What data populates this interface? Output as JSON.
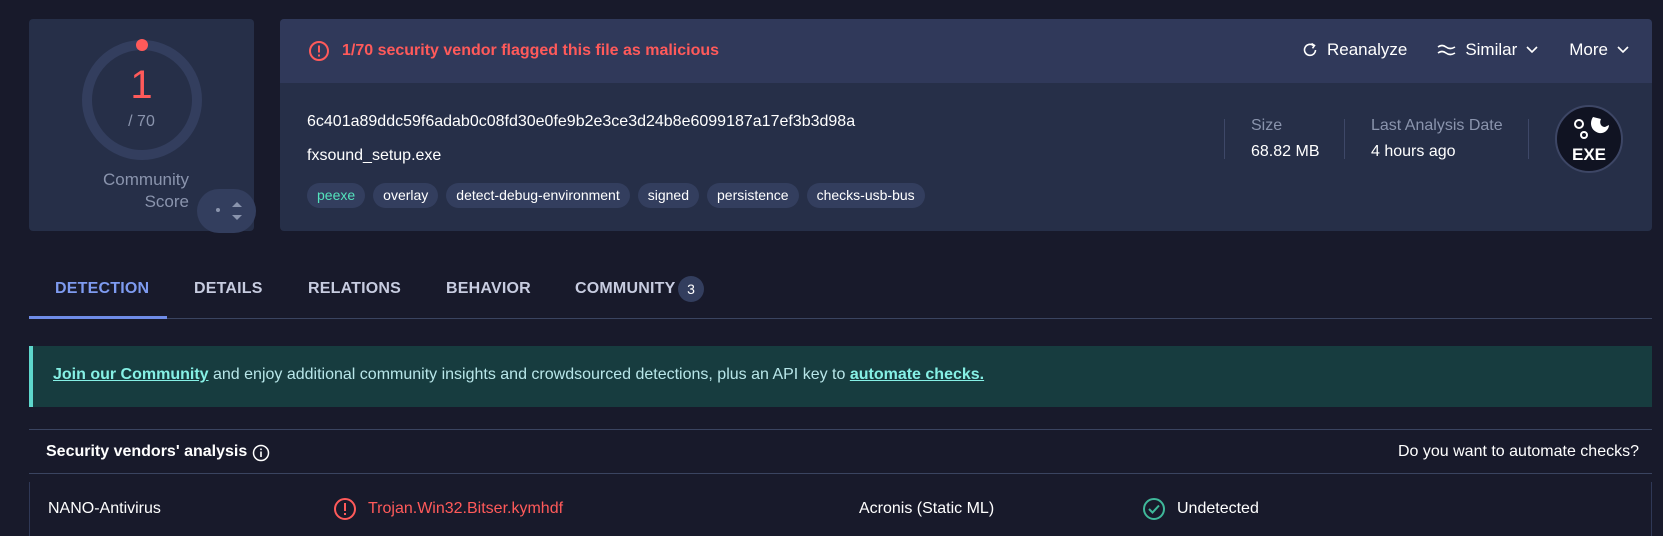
{
  "score": {
    "detections": "1",
    "total": "/ 70",
    "community_label_1": "Community",
    "community_label_2": "Score",
    "detection_ratio": 0.0143
  },
  "alert": {
    "text": "1/70 security vendor flagged this file as malicious"
  },
  "actions": {
    "reanalyze": "Reanalyze",
    "similar": "Similar",
    "more": "More"
  },
  "file": {
    "hash": "6c401a89ddc59f6adab0c08fd30e0fe9b2e3ce3d24b8e6099187a17ef3b3d98a",
    "name": "fxsound_setup.exe",
    "tags": [
      "peexe",
      "overlay",
      "detect-debug-environment",
      "signed",
      "persistence",
      "checks-usb-bus"
    ],
    "size_label": "Size",
    "size_value": "68.82 MB",
    "date_label": "Last Analysis Date",
    "date_value": "4 hours ago",
    "type_badge": "EXE"
  },
  "tabs": [
    {
      "label": "DETECTION"
    },
    {
      "label": "DETAILS"
    },
    {
      "label": "RELATIONS"
    },
    {
      "label": "BEHAVIOR"
    },
    {
      "label": "COMMUNITY",
      "count": "3"
    }
  ],
  "banner": {
    "link1": "Join our Community",
    "middle": " and enjoy additional community insights and crowdsourced detections, plus an API key to ",
    "link2": "automate checks."
  },
  "vendors": {
    "title": "Security vendors' analysis",
    "automate": "Do you want to automate checks?",
    "rows": [
      {
        "vendor1": "NANO-Antivirus",
        "result1": "Trojan.Win32.Bitser.kymhdf",
        "vendor2": "Acronis (Static ML)",
        "result2": "Undetected"
      }
    ]
  },
  "colors": {
    "malicious": "#ff5a5a",
    "accent": "#7e9bf0",
    "clean": "#3fb89a",
    "tag_green": "#54e3bd"
  }
}
